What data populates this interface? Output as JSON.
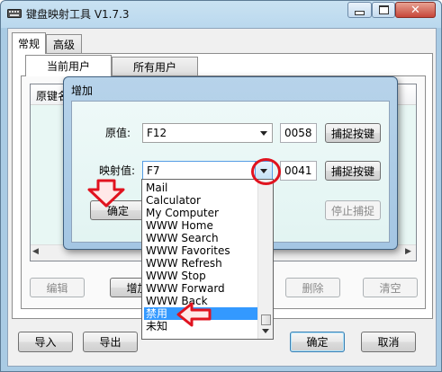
{
  "window": {
    "title": "键盘映射工具 V1.7.3"
  },
  "tabs": [
    {
      "label": "常规"
    },
    {
      "label": "高级"
    }
  ],
  "subtabs": [
    {
      "label": "当前用户"
    },
    {
      "label": "所有用户"
    }
  ],
  "list": {
    "columns": [
      "原键名"
    ],
    "scroll_left": "◀",
    "scroll_right": "▶"
  },
  "panel_buttons": {
    "edit": "编辑",
    "add": "增加",
    "delete": "删除",
    "clear": "清空"
  },
  "bottom_buttons": {
    "import": "导入",
    "export": "导出",
    "ok": "确定",
    "cancel": "取消"
  },
  "dialog": {
    "title": "增加",
    "original_label": "原值:",
    "original_value": "F12",
    "original_code": "0058",
    "capture_label_1": "捕捉按键",
    "mapped_label": "映射值:",
    "mapped_value": "F7",
    "mapped_code": "0041",
    "capture_label_2": "捕捉按键",
    "stop_capture_label": "停止捕捉",
    "ok_label": "确定"
  },
  "dropdown": {
    "items": [
      "Mail",
      "Calculator",
      "My Computer",
      "WWW Home",
      "WWW Search",
      "WWW Favorites",
      "WWW Refresh",
      "WWW Stop",
      "WWW Forward",
      "WWW Back",
      "禁用",
      "未知"
    ],
    "selected_index": 10
  },
  "colors": {
    "annotation_red": "#e0131f",
    "selection_blue": "#3399ff"
  }
}
